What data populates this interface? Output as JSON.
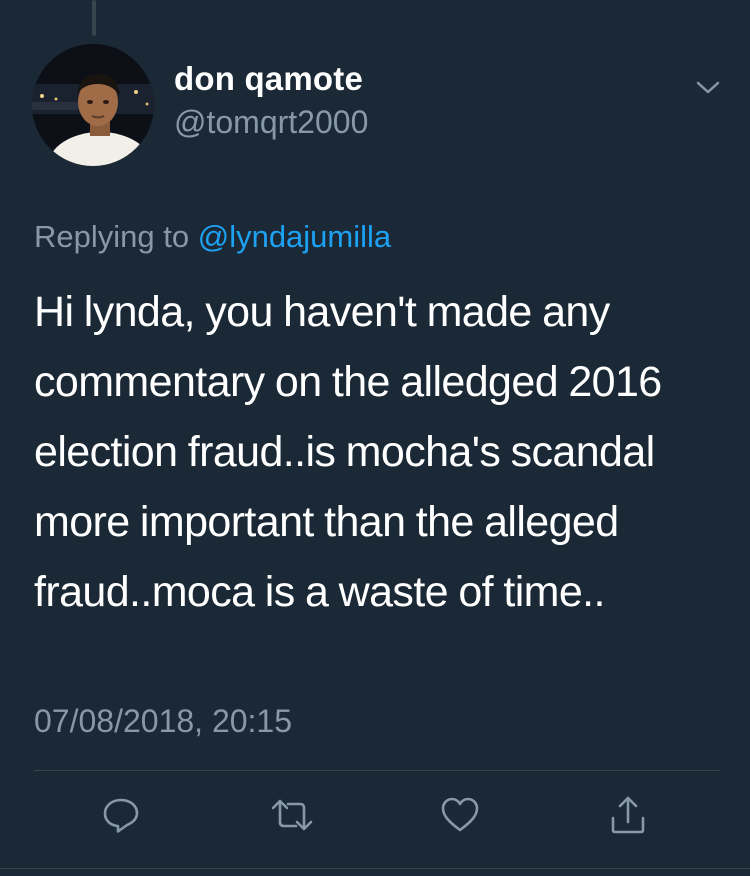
{
  "tweet": {
    "display_name": "don qamote",
    "handle": "@tomqrt2000",
    "replying_prefix": "Replying to",
    "replying_to": "@lyndajumilla",
    "text": "Hi lynda, you haven't made any commentary on the alledged 2016 election fraud..is mocha's scandal more important than the alleged fraud..moca is a waste of time..",
    "timestamp": "07/08/2018, 20:15"
  },
  "icons": {
    "more": "chevron-down-icon",
    "reply": "reply-icon",
    "retweet": "retweet-icon",
    "like": "like-icon",
    "share": "share-icon"
  },
  "colors": {
    "background": "#1b2836",
    "secondary_text": "#8899a6",
    "accent": "#1da1f2",
    "divider": "#38444d"
  }
}
